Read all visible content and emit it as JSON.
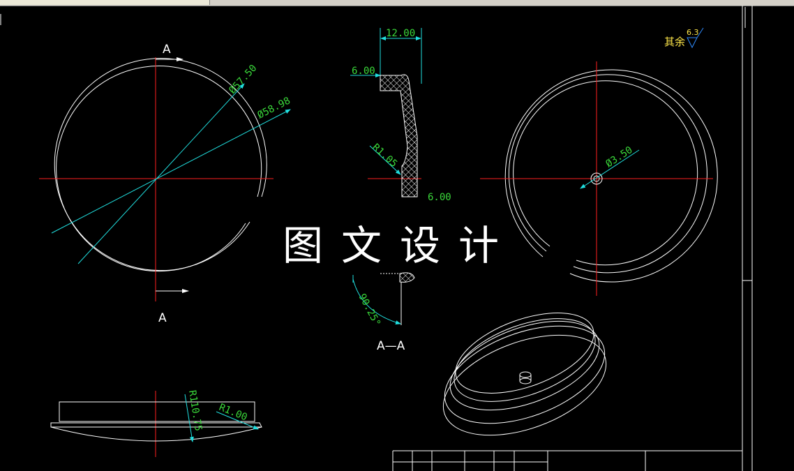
{
  "watermark": "图文设计",
  "drawing": {
    "dimensions": {
      "d1": "Ø57.50",
      "d2": "Ø58.98",
      "width": "12.00",
      "depth": "6.00",
      "lower_depth": "6.00",
      "fillet": "R1.05",
      "hole": "Ø3.50",
      "angle": "90.25°",
      "arc_radius": "R110.75",
      "edge_radius": "R1.00"
    },
    "section_marker_top": "A",
    "section_marker_bottom": "A",
    "section_label": "A—A",
    "roughness_prefix": "其余",
    "roughness_value": "6.3"
  },
  "colors": {
    "background": "#000000",
    "geometry": "#ffffff",
    "centerline": "#ff2020",
    "dimension_line": "#20e0e0",
    "dimension_text": "#3ad83a",
    "roughness_text": "#ffe84a",
    "roughness_symbol": "#2f8cff"
  }
}
